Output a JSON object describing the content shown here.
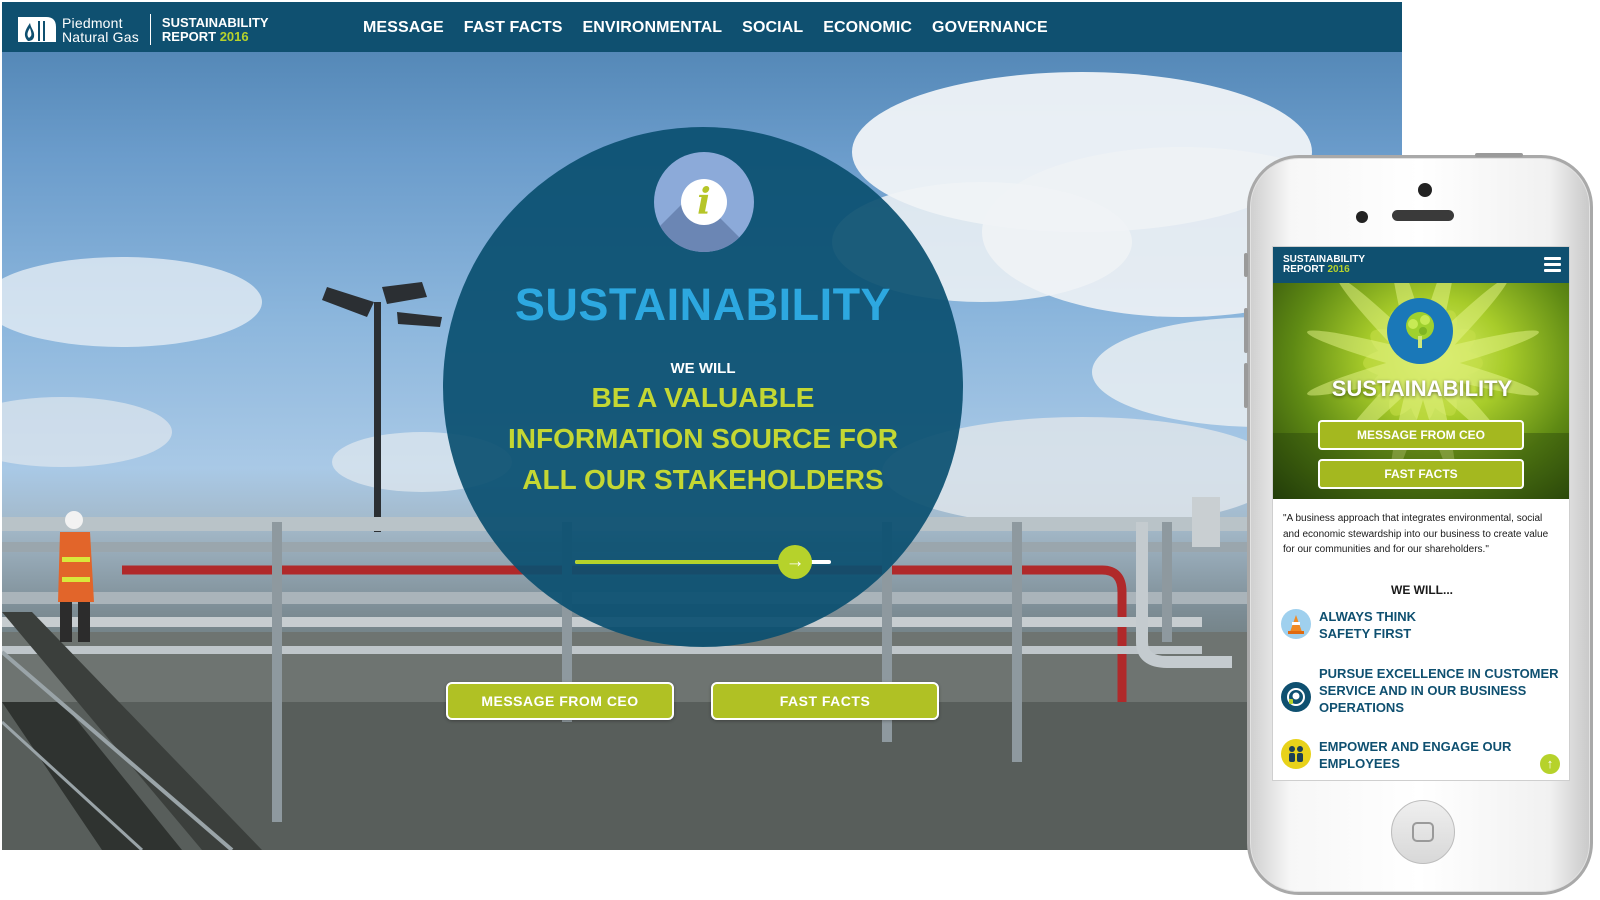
{
  "desktop": {
    "logo": {
      "company_line1": "Piedmont",
      "company_line2": "Natural Gas",
      "report_line1": "SUSTAINABILITY",
      "report_word": "REPORT",
      "report_year": "2016"
    },
    "nav": [
      "MESSAGE",
      "FAST FACTS",
      "ENVIRONMENTAL",
      "SOCIAL",
      "ECONOMIC",
      "GOVERNANCE"
    ],
    "hero": {
      "icon": "info-icon",
      "info_glyph": "i",
      "title": "SUSTAINABILITY",
      "we_will": "WE WILL",
      "mission_lines": [
        "BE A VALUABLE",
        "INFORMATION SOURCE FOR",
        "ALL OUR STAKEHOLDERS"
      ],
      "slider_progress": 0.86,
      "slider_icon": "arrow-right-icon",
      "slider_glyph": "→"
    },
    "buttons": {
      "ceo": "MESSAGE FROM CEO",
      "facts": "FAST FACTS"
    }
  },
  "mobile": {
    "brand_line1": "SUSTAINABILITY",
    "brand_word": "REPORT",
    "brand_year": "2016",
    "menu_icon": "hamburger-menu-icon",
    "hero_icon": "tree-icon",
    "title": "SUSTAINABILITY",
    "buttons": {
      "ceo": "MESSAGE FROM CEO",
      "facts": "FAST FACTS"
    },
    "quote": "\"A business approach that integrates environmental, social and economic stewardship into our business to create value for our communities and for our shareholders.\"",
    "we_will": "WE WILL...",
    "items": [
      {
        "icon": "safety-cone-icon",
        "line1": "ALWAYS THINK",
        "line2": "SAFETY FIRST",
        "line3": ""
      },
      {
        "icon": "customer-service-icon",
        "line1": "PURSUE EXCELLENCE IN CUSTOMER",
        "line2": "SERVICE AND IN OUR BUSINESS",
        "line3": "OPERATIONS"
      },
      {
        "icon": "employees-icon",
        "line1": "EMPOWER AND ENGAGE OUR",
        "line2": "EMPLOYEES",
        "line3": ""
      }
    ],
    "scroll_up_icon": "arrow-up-icon",
    "scroll_up_glyph": "↑"
  },
  "colors": {
    "navy": "#0f5070",
    "lime": "#b6d22b",
    "sky_blue": "#2da8e0",
    "info_badge": "#8caad9"
  }
}
